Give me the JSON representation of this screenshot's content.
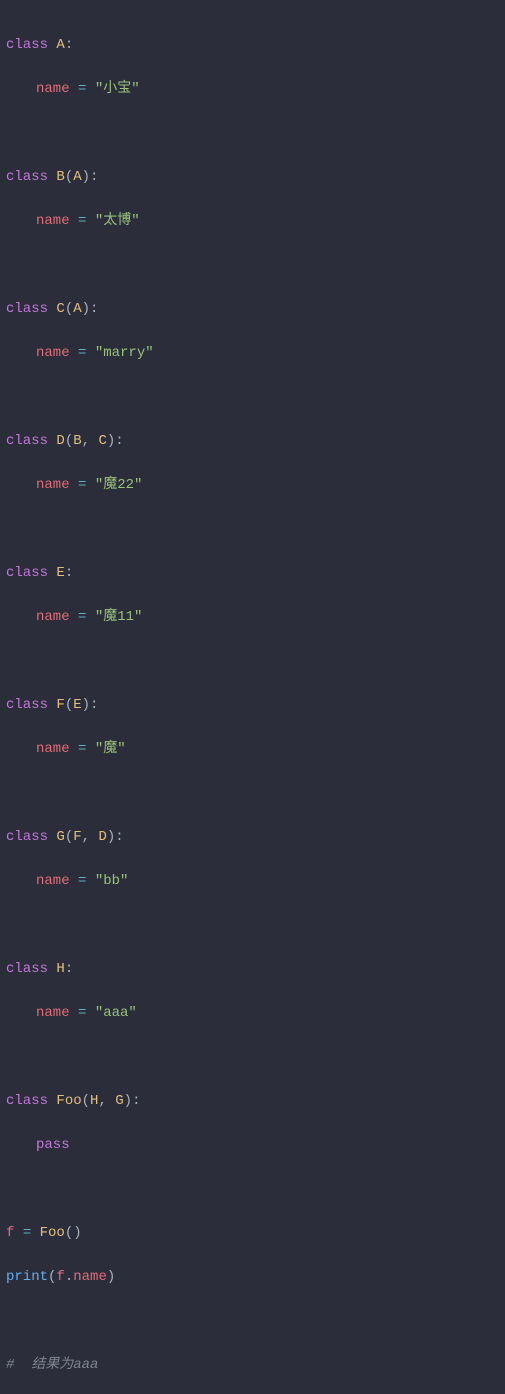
{
  "code": {
    "classes": [
      {
        "name": "A",
        "bases": "",
        "attr": "name",
        "value": "\"小宝\""
      },
      {
        "name": "B",
        "bases": "A",
        "attr": "name",
        "value": "\"太博\""
      },
      {
        "name": "C",
        "bases": "A",
        "attr": "name",
        "value": "\"marry\""
      },
      {
        "name": "D",
        "bases_multi": [
          "B",
          "C"
        ],
        "attr": "name",
        "value": "\"魔22\""
      },
      {
        "name": "E",
        "bases": "",
        "attr": "name",
        "value": "\"魔11\""
      },
      {
        "name": "F",
        "bases": "E",
        "attr": "name",
        "value": "\"魔\""
      },
      {
        "name": "G",
        "bases_multi": [
          "F",
          "D"
        ],
        "attr": "name",
        "value": "\"bb\""
      },
      {
        "name": "H",
        "bases": "",
        "attr": "name",
        "value": "\"aaa\""
      }
    ],
    "foo_class": {
      "name": "Foo",
      "bases_multi": [
        "H",
        "G"
      ],
      "body": "pass"
    },
    "instance": {
      "var": "f",
      "cls": "Foo"
    },
    "print_call": {
      "func": "print",
      "obj": "f",
      "attr": "name"
    },
    "comment": "#  结果为aaa",
    "kw_class": "class",
    "kw_pass": "pass",
    "op_eq": "=",
    "punc_colon": ":",
    "punc_open": "(",
    "punc_close": ")",
    "punc_comma": ",",
    "punc_dot": "."
  }
}
